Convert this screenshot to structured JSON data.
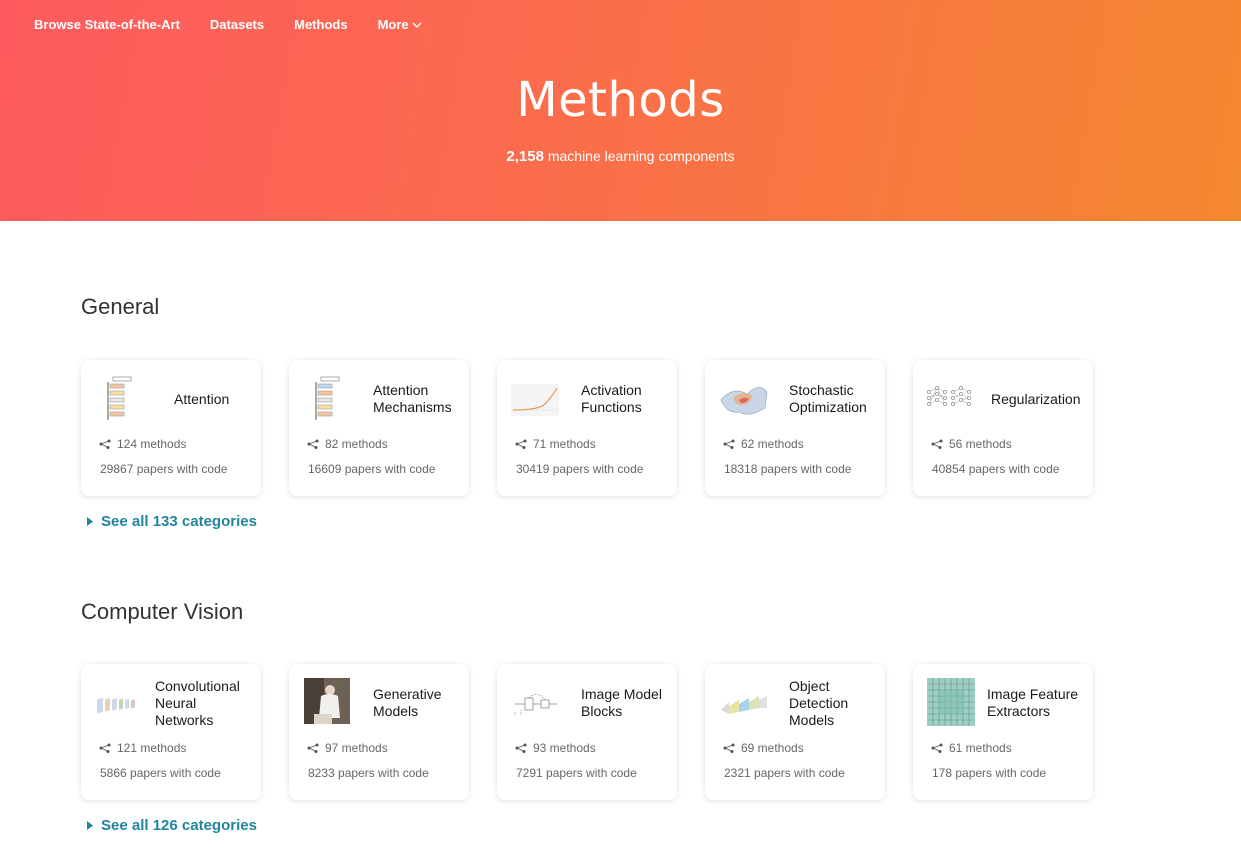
{
  "nav": {
    "items": [
      "Browse State-of-the-Art",
      "Datasets",
      "Methods",
      "More"
    ]
  },
  "hero": {
    "title": "Methods",
    "count": "2,158",
    "subtitle": "machine learning components"
  },
  "sections": [
    {
      "title": "General",
      "see_all": "See all 133 categories",
      "cards": [
        {
          "name": "Attention",
          "methods": "124 methods",
          "papers": "29867 papers with code",
          "icon": "attention-diagram-icon"
        },
        {
          "name": "Attention Mechanisms",
          "methods": "82 methods",
          "papers": "16609 papers with code",
          "icon": "attention-mechanism-diagram-icon"
        },
        {
          "name": "Activation Functions",
          "methods": "71 methods",
          "papers": "30419 papers with code",
          "icon": "activation-curve-icon"
        },
        {
          "name": "Stochastic Optimization",
          "methods": "62 methods",
          "papers": "18318 papers with code",
          "icon": "loss-surface-icon"
        },
        {
          "name": "Regularization",
          "methods": "56 methods",
          "papers": "40854 papers with code",
          "icon": "dropout-network-icon"
        }
      ]
    },
    {
      "title": "Computer Vision",
      "see_all": "See all 126 categories",
      "cards": [
        {
          "name": "Convolutional Neural Networks",
          "methods": "121 methods",
          "papers": "5866 papers with code",
          "icon": "cnn-layers-icon"
        },
        {
          "name": "Generative Models",
          "methods": "97 methods",
          "papers": "8233 papers with code",
          "icon": "generated-photo-icon"
        },
        {
          "name": "Image Model Blocks",
          "methods": "93 methods",
          "papers": "7291 papers with code",
          "icon": "model-block-diagram-icon"
        },
        {
          "name": "Object Detection Models",
          "methods": "69 methods",
          "papers": "2321 papers with code",
          "icon": "detection-pipeline-icon"
        },
        {
          "name": "Image Feature Extractors",
          "methods": "61 methods",
          "papers": "178 papers with code",
          "icon": "feature-grid-icon"
        }
      ]
    }
  ]
}
